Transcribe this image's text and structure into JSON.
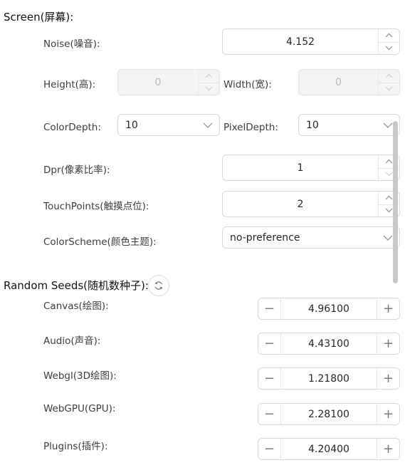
{
  "screen": {
    "title": "Screen(屏幕):",
    "noise": {
      "label": "Noise(噪音):",
      "value": "4.152"
    },
    "height": {
      "label": "Height(高):",
      "value": "0"
    },
    "width": {
      "label": "Width(宽):",
      "value": "0"
    },
    "color_depth": {
      "label": "ColorDepth:",
      "value": "10"
    },
    "pixel_depth": {
      "label": "PixelDepth:",
      "value": "10"
    },
    "dpr": {
      "label": "Dpr(像素比率):",
      "value": "1"
    },
    "touch_points": {
      "label": "TouchPoints(触摸点位):",
      "value": "2"
    },
    "color_scheme": {
      "label": "ColorScheme(颜色主题):",
      "value": "no-preference"
    }
  },
  "random_seeds": {
    "title": "Random Seeds(随机数种子):",
    "canvas": {
      "label": "Canvas(绘图):",
      "value": "4.96100"
    },
    "audio": {
      "label": "Audio(声音):",
      "value": "4.43100"
    },
    "webgl": {
      "label": "Webgl(3D绘图):",
      "value": "1.21800"
    },
    "webgpu": {
      "label": "WebGPU(GPU):",
      "value": "2.28100"
    },
    "plugins": {
      "label": "Plugins(插件):",
      "value": "4.20400"
    }
  },
  "icons": {
    "stepper_minus": "minus-icon",
    "stepper_plus": "plus-icon",
    "spinner_up": "chevron-up-icon",
    "spinner_down": "chevron-down-icon",
    "refresh": "refresh-icon"
  }
}
